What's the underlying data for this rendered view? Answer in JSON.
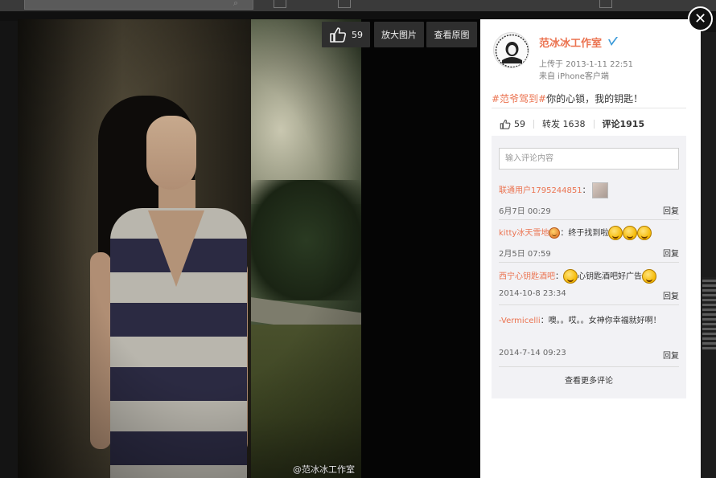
{
  "viewer": {
    "like_count": "59",
    "zoom_label": "放大图片",
    "original_label": "查看原图",
    "watermark": "@范冰冰工作室",
    "close_symbol": "✕"
  },
  "post": {
    "author": "范冰冰工作室",
    "time": "上传于 2013-1-11 22:51",
    "source": "来自 iPhone客户端",
    "topic": "#范爷驾到#",
    "text": "你的心锁，我的钥匙！",
    "likes": "59",
    "repost_label": "转发 1638",
    "comment_label": "评论1915"
  },
  "comments": {
    "input_placeholder": "输入评论内容",
    "items": [
      {
        "user": "联通用户1795244851",
        "text": "：",
        "date": "6月7日 00:29",
        "reply": "回复"
      },
      {
        "user": "kitty冰天雪地",
        "text": "：终于找到啦",
        "date": "2月5日 07:59",
        "reply": "回复"
      },
      {
        "user": "西宁心钥匙酒吧",
        "text": "：",
        "text2": "心钥匙酒吧好广告",
        "date": "2014-10-8 23:34",
        "reply": "回复"
      },
      {
        "user": "-Vermicelli",
        "text": "：噢。。哎。。女神你幸福就好啊！",
        "date": "2014-7-14 09:23",
        "reply": "回复"
      }
    ],
    "more_label": "查看更多评论"
  },
  "colors": {
    "accent": "#eb7350",
    "verified": "#3a9ad9",
    "panel_bg": "#ffffff",
    "comment_bg": "#f2f2f5"
  },
  "icons": [
    "thumbs-up-icon",
    "verified-icon",
    "close-icon",
    "emoji-icon",
    "search-icon"
  ]
}
